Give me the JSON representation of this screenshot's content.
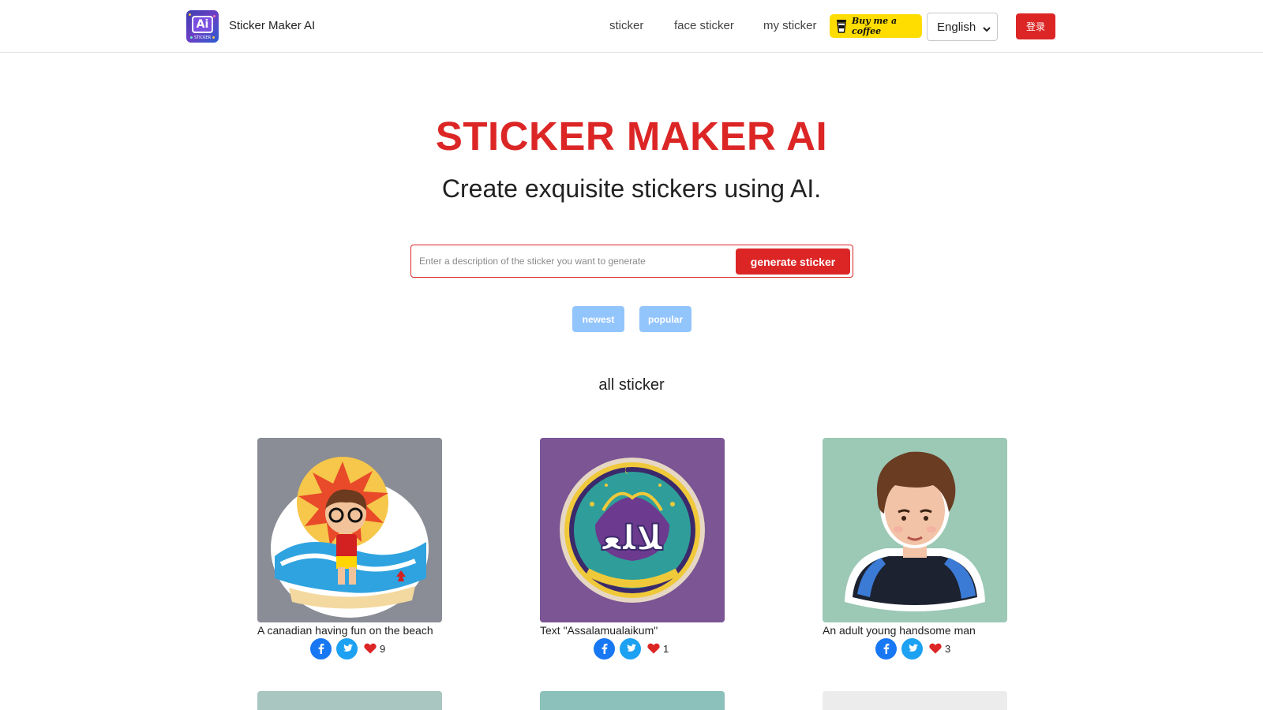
{
  "header": {
    "brand": "Sticker Maker AI",
    "logo_text": "Ai",
    "logo_subtext": "STICKER",
    "nav": [
      "sticker",
      "face sticker",
      "my sticker"
    ],
    "coffee_label": "Buy me a coffee",
    "language": "English",
    "login_label": "登录"
  },
  "hero": {
    "title": "STICKER MAKER AI",
    "subtitle": "Create exquisite stickers using AI."
  },
  "search": {
    "placeholder": "Enter a description of the sticker you want to generate",
    "value": "",
    "button": "generate sticker"
  },
  "filters": [
    "newest",
    "popular"
  ],
  "section_title": "all sticker",
  "stickers": [
    {
      "caption": "A canadian having fun on the beach",
      "likes": "9"
    },
    {
      "caption": "Text \"Assalamualaikum\"",
      "likes": "1"
    },
    {
      "caption": "An adult young handsome man",
      "likes": "3"
    }
  ],
  "colors": {
    "accent": "#dc2626",
    "pill": "#93c5fd",
    "coffee": "#ffdd00",
    "facebook": "#1877f2",
    "twitter": "#1da1f2"
  },
  "icons": {
    "logo": "ai-sticker-logo",
    "coffee": "coffee-cup-icon",
    "dropdown": "chevron-down-icon",
    "facebook": "facebook-icon",
    "twitter": "twitter-icon",
    "like": "heart-icon"
  }
}
